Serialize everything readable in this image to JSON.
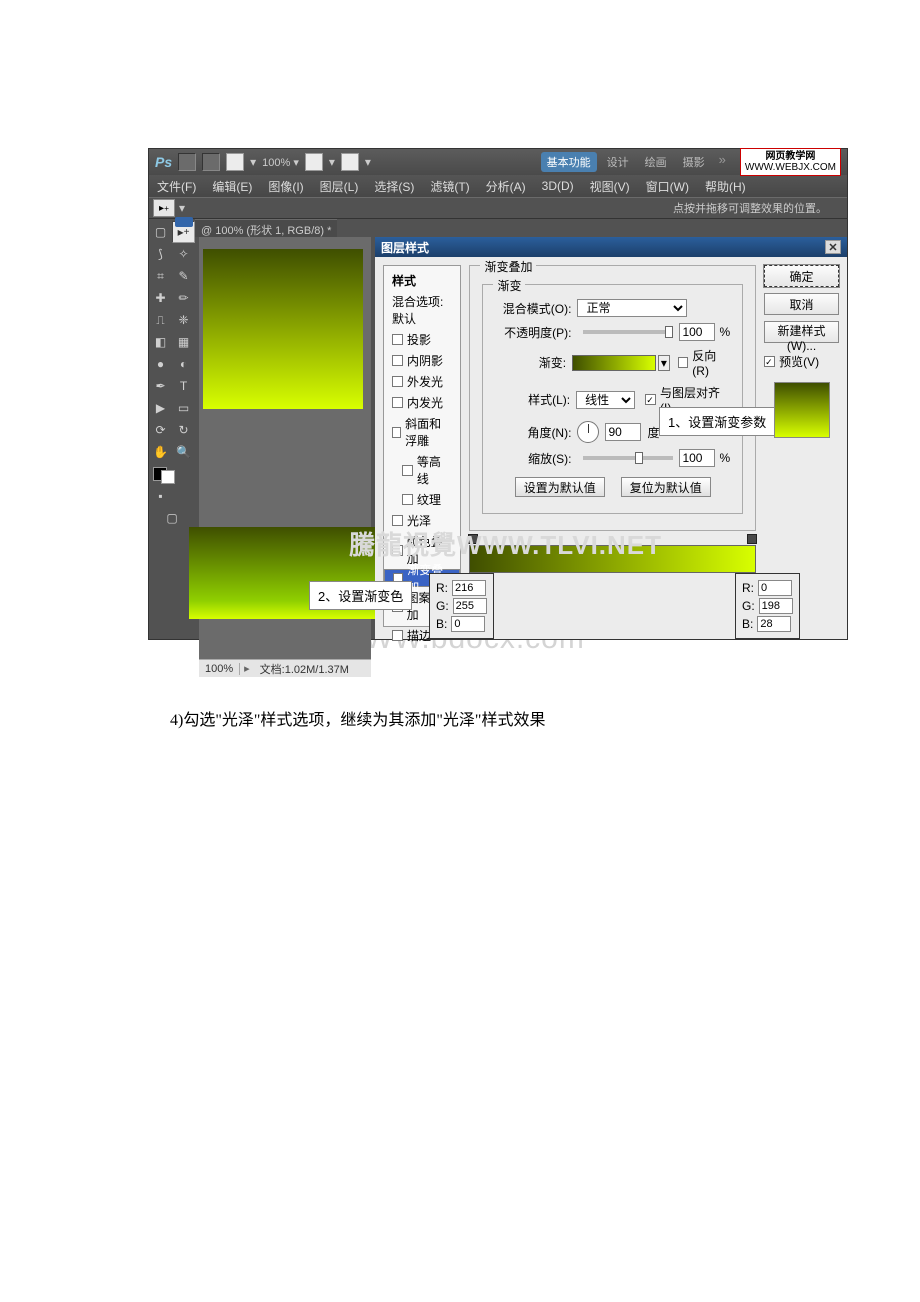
{
  "app": {
    "name": "Ps",
    "zoom_top": "100% ▾"
  },
  "workspaces": {
    "active": "基本功能",
    "others": [
      "设计",
      "绘画",
      "摄影"
    ]
  },
  "site_badge": {
    "cn": "网页教学网",
    "url": "WWW.WEBJX.COM"
  },
  "menu": [
    "文件(F)",
    "编辑(E)",
    "图像(I)",
    "图层(L)",
    "选择(S)",
    "滤镜(T)",
    "分析(A)",
    "3D(D)",
    "视图(V)",
    "窗口(W)",
    "帮助(H)"
  ],
  "optbar_hint": "点按并拖移可调整效果的位置。",
  "doc_tab": "@ 100% (形状 1, RGB/8) *",
  "status": {
    "zoom": "100%",
    "docinfo": "文档:1.02M/1.37M"
  },
  "dialog": {
    "title": "图层样式",
    "styles_header": "样式",
    "blend_defaults": "混合选项:默认",
    "items": [
      {
        "label": "投影",
        "checked": false
      },
      {
        "label": "内阴影",
        "checked": false
      },
      {
        "label": "外发光",
        "checked": false
      },
      {
        "label": "内发光",
        "checked": false
      },
      {
        "label": "斜面和浮雕",
        "checked": false
      },
      {
        "label": "等高线",
        "checked": false,
        "sub": true
      },
      {
        "label": "纹理",
        "checked": false,
        "sub": true
      },
      {
        "label": "光泽",
        "checked": false
      },
      {
        "label": "颜色叠加",
        "checked": false
      },
      {
        "label": "渐变叠加",
        "checked": true,
        "selected": true
      },
      {
        "label": "图案叠加",
        "checked": false
      },
      {
        "label": "描边",
        "checked": false
      }
    ],
    "section_title": "渐变叠加",
    "subsection": "渐变",
    "labels": {
      "blend_mode": "混合模式(O):",
      "blend_mode_value": "正常",
      "opacity": "不透明度(P):",
      "opacity_value": "100",
      "pct": "%",
      "gradient": "渐变:",
      "reverse": "反向(R)",
      "style": "样式(L):",
      "style_value": "线性",
      "align": "与图层对齐(I)",
      "angle": "角度(N):",
      "angle_value": "90",
      "deg": "度",
      "scale": "缩放(S):",
      "scale_value": "100",
      "set_default": "设置为默认值",
      "reset_default": "复位为默认值"
    },
    "buttons": {
      "ok": "确定",
      "cancel": "取消",
      "new_style": "新建样式(W)...",
      "preview": "预览(V)"
    }
  },
  "callouts": {
    "c1": "1、设置渐变参数",
    "c2": "2、设置渐变色"
  },
  "rgb_left": {
    "r": "216",
    "g": "255",
    "b": "0"
  },
  "rgb_right": {
    "r": "0",
    "g": "198",
    "b": "28"
  },
  "teng_long_watermark": "騰龍視覺WWW.TLVI.NET",
  "bdocx_watermark": "WWW.bdocx.com",
  "body_text": "4)勾选\"光泽\"样式选项，继续为其添加\"光泽\"样式效果"
}
